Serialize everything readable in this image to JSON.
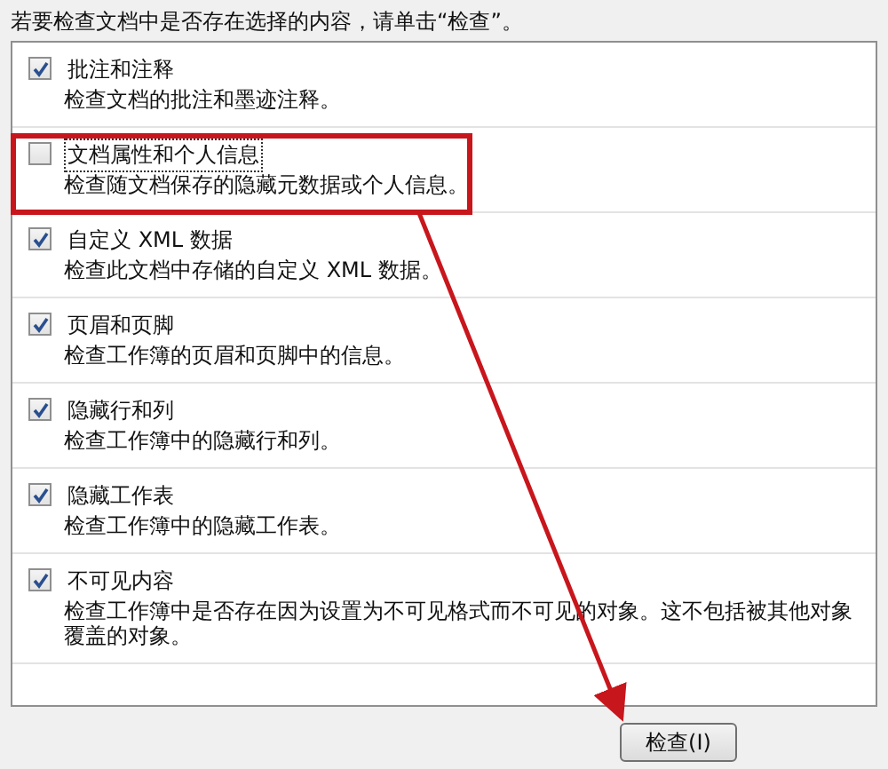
{
  "instruction": "若要检查文档中是否存在选择的内容，请单击“检查”。",
  "items": [
    {
      "title": "批注和注释",
      "description": "检查文档的批注和墨迹注释。",
      "checked": true,
      "focused": false
    },
    {
      "title": "文档属性和个人信息",
      "description": "检查随文档保存的隐藏元数据或个人信息。",
      "checked": false,
      "focused": true
    },
    {
      "title": "自定义 XML 数据",
      "description": "检查此文档中存储的自定义 XML 数据。",
      "checked": true,
      "focused": false
    },
    {
      "title": "页眉和页脚",
      "description": "检查工作簿的页眉和页脚中的信息。",
      "checked": true,
      "focused": false
    },
    {
      "title": "隐藏行和列",
      "description": "检查工作簿中的隐藏行和列。",
      "checked": true,
      "focused": false
    },
    {
      "title": "隐藏工作表",
      "description": "检查工作簿中的隐藏工作表。",
      "checked": true,
      "focused": false
    },
    {
      "title": "不可见内容",
      "description": "检查工作簿中是否存在因为设置为不可见格式而不可见的对象。这不包括被其他对象覆盖的对象。",
      "checked": true,
      "focused": false
    }
  ],
  "button": "检查(I)"
}
